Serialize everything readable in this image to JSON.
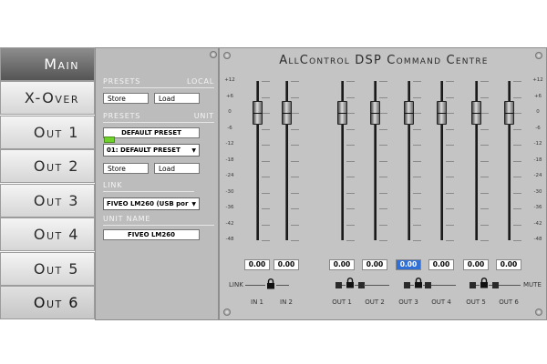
{
  "nav": {
    "tabs": [
      {
        "label": "Main",
        "state": "active"
      },
      {
        "label": "X-Over",
        "state": "normal"
      },
      {
        "label": "Out 1",
        "state": "normal"
      },
      {
        "label": "Out 2",
        "state": "normal"
      },
      {
        "label": "Out 3",
        "state": "normal"
      },
      {
        "label": "Out 4",
        "state": "normal"
      },
      {
        "label": "Out 5",
        "state": "normal"
      },
      {
        "label": "Out 6",
        "state": "pressed"
      }
    ]
  },
  "presets_local": {
    "title": "Presets",
    "qualifier": "Local",
    "store_label": "Store",
    "load_label": "Load"
  },
  "presets_unit": {
    "title": "Presets",
    "qualifier": "Unit",
    "current_name": "DEFAULT PRESET",
    "selected_option": "01:  DEFAULT PRESET",
    "store_label": "Store",
    "load_label": "Load"
  },
  "link": {
    "title": "Link",
    "status_color": "#6fd22a",
    "device_option": "FIVEO LM260 (USB por"
  },
  "unit_name": {
    "title": "Unit Name",
    "value": "FIVEO LM260"
  },
  "mixer": {
    "title": "AllControl DSP Command Centre",
    "scale": [
      "+12",
      "+6",
      "0",
      "-6",
      "-12",
      "-18",
      "-24",
      "-30",
      "-36",
      "-42",
      "-48"
    ],
    "inputs": [
      {
        "label": "IN 1",
        "value": "0.00",
        "level_db": 0
      },
      {
        "label": "IN 2",
        "value": "0.00",
        "level_db": 0
      }
    ],
    "outputs": [
      {
        "label": "OUT 1",
        "value": "0.00",
        "level_db": 0
      },
      {
        "label": "OUT 2",
        "value": "0.00",
        "level_db": 0
      },
      {
        "label": "OUT 3",
        "value": "0.00",
        "level_db": 0,
        "selected": true
      },
      {
        "label": "OUT 4",
        "value": "0.00",
        "level_db": 0
      },
      {
        "label": "OUT 5",
        "value": "0.00",
        "level_db": 0
      },
      {
        "label": "OUT 6",
        "value": "0.00",
        "level_db": 0
      }
    ],
    "link_label": "LINK",
    "mute_label": "MUTE",
    "link_icon": "lock-icon"
  }
}
